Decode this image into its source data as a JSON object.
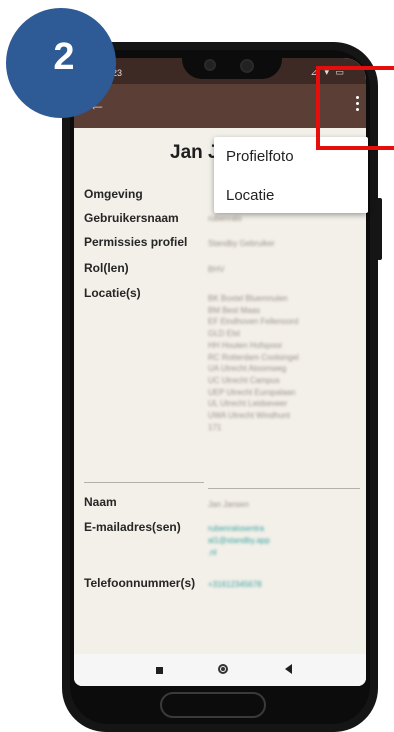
{
  "step_badge": "2",
  "status_bar": {
    "time": "23",
    "icons": "⊿ ▾ ▭"
  },
  "app_bar": {
    "back_icon": "arrow-left-icon",
    "more_icon": "more-vert-icon"
  },
  "profile": {
    "name": "Jan J",
    "labels": {
      "omgeving": "Omgeving",
      "gebruikersnaam": "Gebruikersnaam",
      "permissies": "Permissies profiel",
      "rol": "Rol(len)",
      "locaties": "Locatie(s)",
      "naam": "Naam",
      "email": "E-mailadres(sen)",
      "telefoon": "Telefoonnummer(s)"
    },
    "values": {
      "omgeving": "",
      "gebruikersnaam": "rubenralo",
      "permissies": "Standby Gebruiker",
      "rol": "BHV",
      "locaties": [
        "BK Boxtel Bluemnulen",
        "BM Best Maas",
        "EF Eindhoven Fellenoord",
        "GLD Elst",
        "HH Houten Hofspoor",
        "RC Rotterdam Coolsingel",
        "UA Utrecht Atoomweg",
        "UC Utrecht Campus",
        "UEP Utrecht Europalaan",
        "UL Utrecht Leidseveer",
        "UWA Utrecht Windhunt",
        "171"
      ],
      "naam": "Jan Jansen",
      "email": [
        "rubenralosentra",
        "al1@standby.app",
        ".nl"
      ],
      "telefoon": "+31612345678"
    }
  },
  "menu": {
    "items": [
      "Profielfoto",
      "Locatie"
    ]
  },
  "colors": {
    "status_bar": "#3e2a25",
    "app_bar": "#5b3f36",
    "background": "#f3efe9",
    "badge": "#2e5a95",
    "highlight": "#e60d0d"
  }
}
